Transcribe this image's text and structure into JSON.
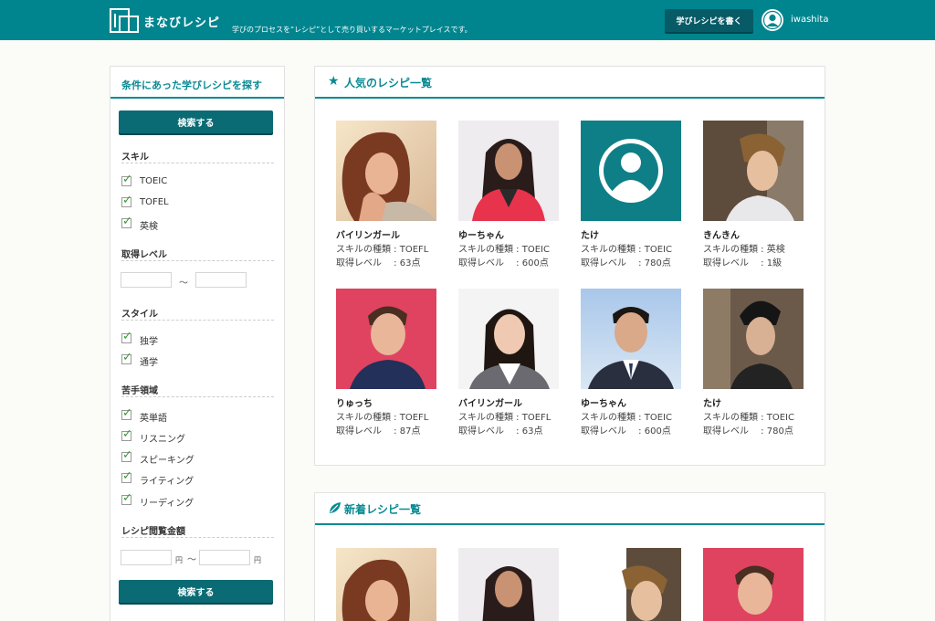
{
  "colors": {
    "header": "#00858f",
    "accent": "#0a8a94",
    "button": "#0b6b74",
    "check": "#3a9a3a"
  },
  "header": {
    "logo_text": "まなびレシピ",
    "tagline": "学びのプロセスを“レシピ”として売り買いするマーケットプレイスです。",
    "write_button": "学びレシピを書く",
    "username": "iwashita"
  },
  "sidebar": {
    "title": "条件にあった学びレシピを探す",
    "search_button": "検索する",
    "skill_heading": "スキル",
    "skills": [
      "TOEIC",
      "TOFEL",
      "英検"
    ],
    "level_heading": "取得レベル",
    "level_sep": "〜",
    "style_heading": "スタイル",
    "styles": [
      "独学",
      "通学"
    ],
    "weak_heading": "苦手領域",
    "weak_areas": [
      "英単語",
      "リスニング",
      "スピーキング",
      "ライティング",
      "リーディング"
    ],
    "price_heading": "レシピ閲覧金額",
    "price_unit": "円",
    "price_sep": "〜",
    "search_button_bottom": "検索する"
  },
  "popular": {
    "title": "人気のレシピ一覧",
    "icon": "star-icon",
    "cards": [
      {
        "name": "バイリンガール",
        "skill": "スキルの種類 : TOEFL",
        "level": "取得レベル 　: 63点",
        "photo": "woman-sunlit"
      },
      {
        "name": "ゆーちゃん",
        "skill": "スキルの種類 : TOEIC",
        "level": "取得レベル 　: 600点",
        "photo": "woman-pink"
      },
      {
        "name": "たけ",
        "skill": "スキルの種類 : TOEIC",
        "level": "取得レベル 　: 780点",
        "photo": "default-avatar"
      },
      {
        "name": "きんきん",
        "skill": "スキルの種類 : 英検",
        "level": "取得レベル 　: 1級",
        "photo": "man-brown-hair"
      },
      {
        "name": "りゅっち",
        "skill": "スキルの種類 : TOEFL",
        "level": "取得レベル 　: 87点",
        "photo": "man-pink-bg"
      },
      {
        "name": "バイリンガール",
        "skill": "スキルの種類 : TOEFL",
        "level": "取得レベル 　: 63点",
        "photo": "woman-suit"
      },
      {
        "name": "ゆーちゃん",
        "skill": "スキルの種類 : TOEIC",
        "level": "取得レベル 　: 600点",
        "photo": "man-suit"
      },
      {
        "name": "たけ",
        "skill": "スキルの種類 : TOEIC",
        "level": "取得レベル 　: 780点",
        "photo": "man-pompadour"
      }
    ]
  },
  "newest": {
    "title": "新着レシピ一覧",
    "icon": "leaf-icon"
  }
}
